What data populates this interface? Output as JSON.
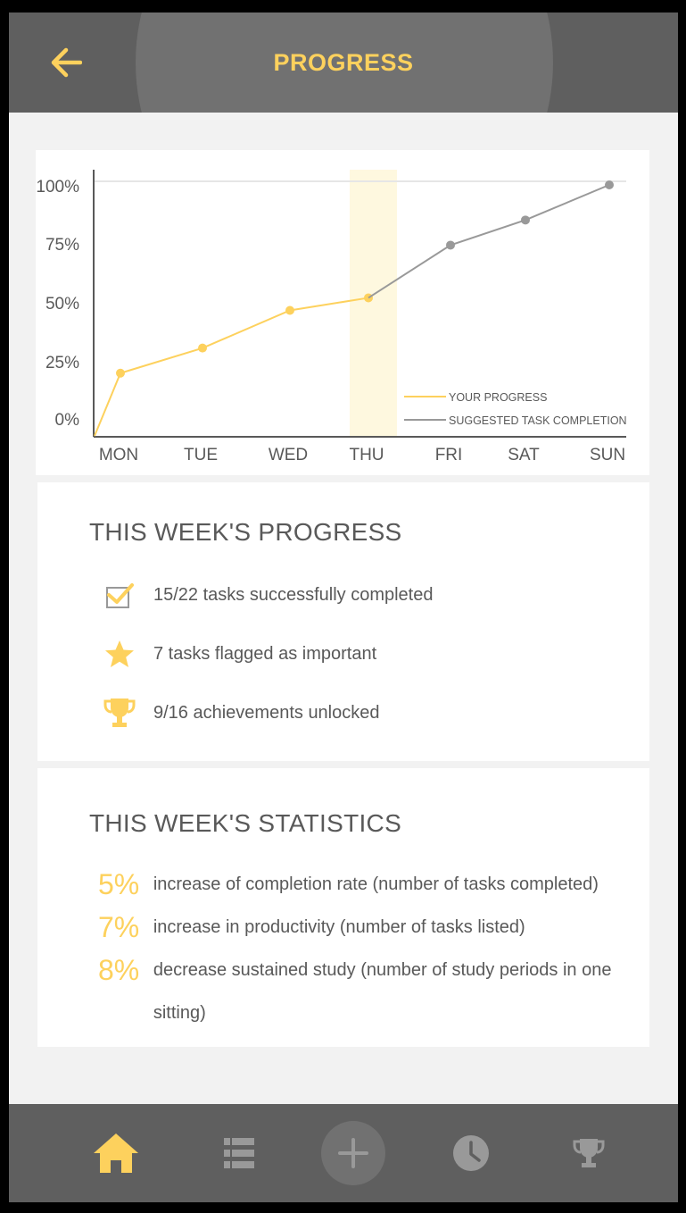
{
  "header": {
    "title": "PROGRESS",
    "back_icon": "arrow-left-icon"
  },
  "chart_data": {
    "type": "line",
    "categories": [
      "MON",
      "TUE",
      "WED",
      "THU",
      "FRI",
      "SAT",
      "SUN"
    ],
    "y_ticks": [
      "100%",
      "75%",
      "50%",
      "25%",
      "0%"
    ],
    "ylim": [
      0,
      100
    ],
    "highlight_category": "THU",
    "series": [
      {
        "name": "YOUR PROGRESS",
        "color": "#fdd15d",
        "points": [
          [
            "start",
            0
          ],
          [
            "MON",
            25
          ],
          [
            "TUE",
            35
          ],
          [
            "WED",
            50
          ],
          [
            "THU",
            55
          ]
        ]
      },
      {
        "name": "SUGGESTED TASK COMPLETION",
        "color": "#999999",
        "points": [
          [
            "THU",
            55
          ],
          [
            "FRI",
            76
          ],
          [
            "SAT",
            86
          ],
          [
            "SUN",
            100
          ]
        ]
      }
    ],
    "legend": "bottom-right",
    "grid": false
  },
  "progress": {
    "title": "THIS WEEK'S PROGRESS",
    "items": [
      {
        "icon": "checkbox-checked-icon",
        "text": "15/22 tasks successfully completed"
      },
      {
        "icon": "star-icon",
        "text": "7 tasks flagged as important"
      },
      {
        "icon": "trophy-icon",
        "text": "9/16 achievements unlocked"
      }
    ]
  },
  "statistics": {
    "title": "THIS WEEK'S STATISTICS",
    "items": [
      {
        "percent": "5%",
        "text": "increase of completion rate (number of tasks completed)"
      },
      {
        "percent": "7%",
        "text": "increase in productivity (number of tasks listed)"
      },
      {
        "percent": "8%",
        "text": "decrease sustained study (number of study periods in one sitting)"
      }
    ]
  },
  "nav": {
    "items": [
      "home-icon",
      "list-icon",
      "plus-icon",
      "clock-icon",
      "trophy-icon"
    ],
    "active": "home-icon"
  },
  "colors": {
    "accent": "#fdd15d",
    "bar": "#5f5f5f",
    "text": "#595959",
    "muted": "#999999"
  }
}
